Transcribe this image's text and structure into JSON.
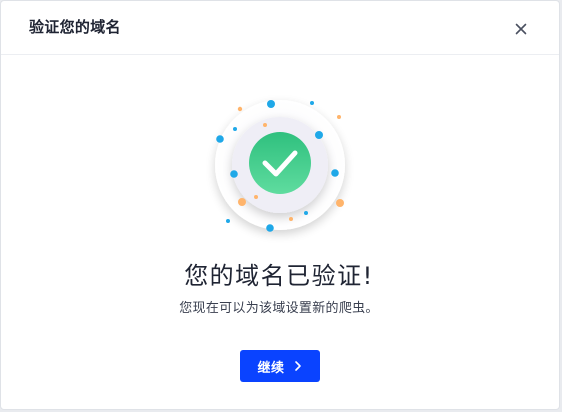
{
  "dialog": {
    "title": "验证您的域名",
    "close_icon": "close-icon"
  },
  "content": {
    "headline": "您的域名已验证!",
    "subtext": "您现在可以为该域设置新的爬虫。",
    "illustration_icon": "checkmark-circle-icon"
  },
  "actions": {
    "continue_label": "继续",
    "continue_icon": "chevron-right-icon"
  },
  "colors": {
    "primary": "#0a43ff",
    "success": "#3fcf8e",
    "confetti_blue": "#1fa8e8",
    "confetti_orange": "#ffb46b"
  }
}
